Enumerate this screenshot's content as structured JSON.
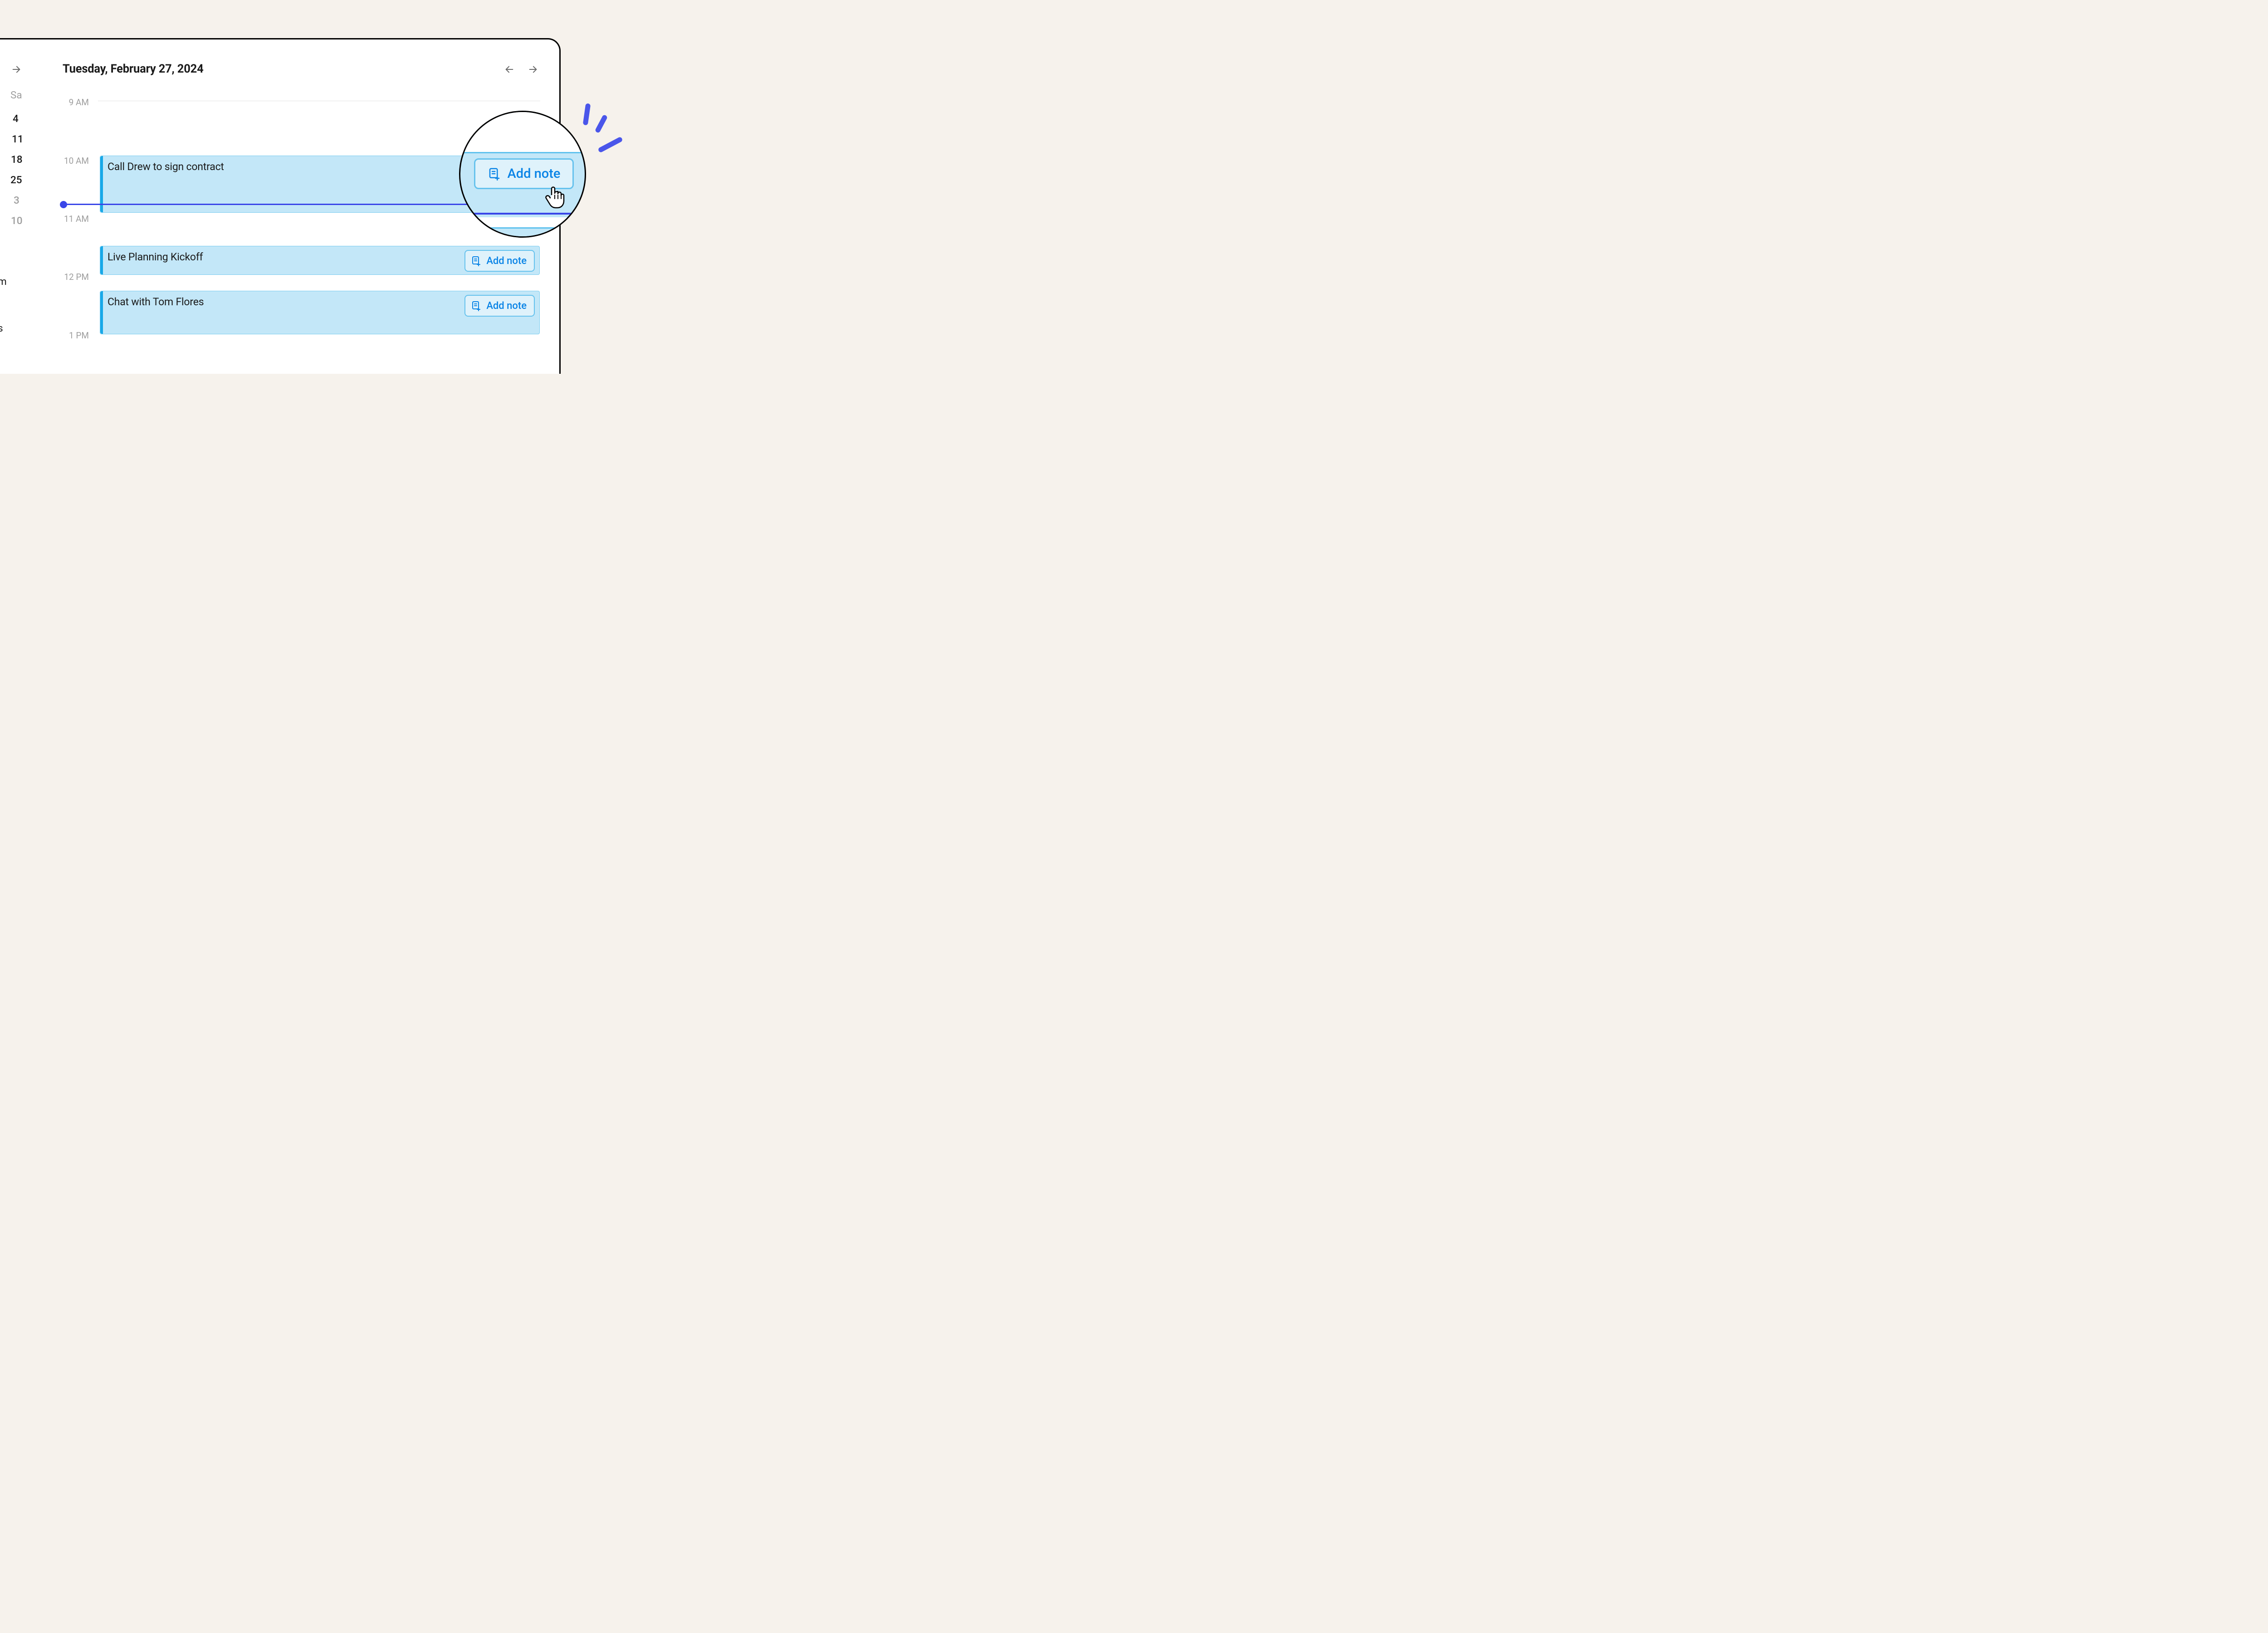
{
  "header": {
    "date_title": "Tuesday, February 27, 2024"
  },
  "sidebar": {
    "day_label": "Sa",
    "dates": [
      "4",
      "11",
      "18",
      "25",
      "3",
      "10"
    ],
    "letters": [
      "m",
      "s"
    ]
  },
  "time_labels": {
    "t9": "9 AM",
    "t10": "10 AM",
    "t11": "11 AM",
    "t12": "12 PM",
    "t13": "1 PM"
  },
  "events": [
    {
      "title": "Call Drew to sign contract",
      "add_note": "Add note"
    },
    {
      "title": "Live Planning Kickoff",
      "add_note": "Add note"
    },
    {
      "title": "Chat with Tom Flores",
      "add_note": "Add note"
    }
  ],
  "magnifier": {
    "add_note": "Add note"
  }
}
